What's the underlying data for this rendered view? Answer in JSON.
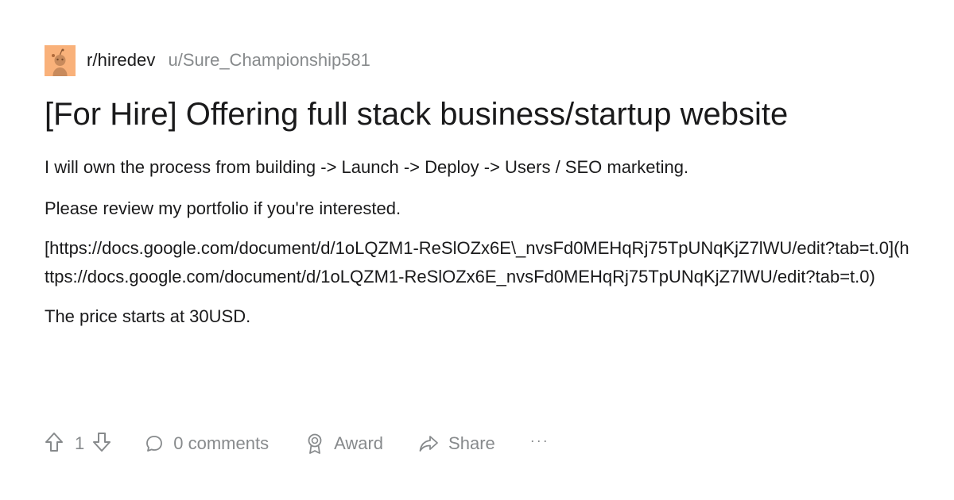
{
  "post": {
    "subreddit": "r/hiredev",
    "author": "u/Sure_Championship581",
    "title": "[For Hire] Offering  full stack business/startup  website",
    "paragraphs": [
      "I will own the process from building -> Launch -> Deploy -> Users / SEO marketing.",
      "Please review my portfolio if you're interested.",
      "[https://docs.google.com/document/d/1oLQZM1-ReSlOZx6E\\_nvsFd0MEHqRj75TpUNqKjZ7lWU/edit?tab=t.0](https://docs.google.com/document/d/1oLQZM1-ReSlOZx6E_nvsFd0MEHqRj75TpUNqKjZ7lWU/edit?tab=t.0)",
      "The price starts at 30USD."
    ]
  },
  "actions": {
    "vote_count": "1",
    "comments_label": "0 comments",
    "award_label": "Award",
    "share_label": "Share",
    "more_label": "···"
  },
  "icons": {
    "avatar": "reddit-snoo-avatar",
    "upvote": "arrow-up-icon",
    "downvote": "arrow-down-icon",
    "comment": "speech-bubble-icon",
    "award": "award-ribbon-icon",
    "share": "share-arrow-icon"
  },
  "colors": {
    "avatar_bg": "#f9b17a",
    "text": "#1a1a1b",
    "muted": "#878a8c"
  }
}
